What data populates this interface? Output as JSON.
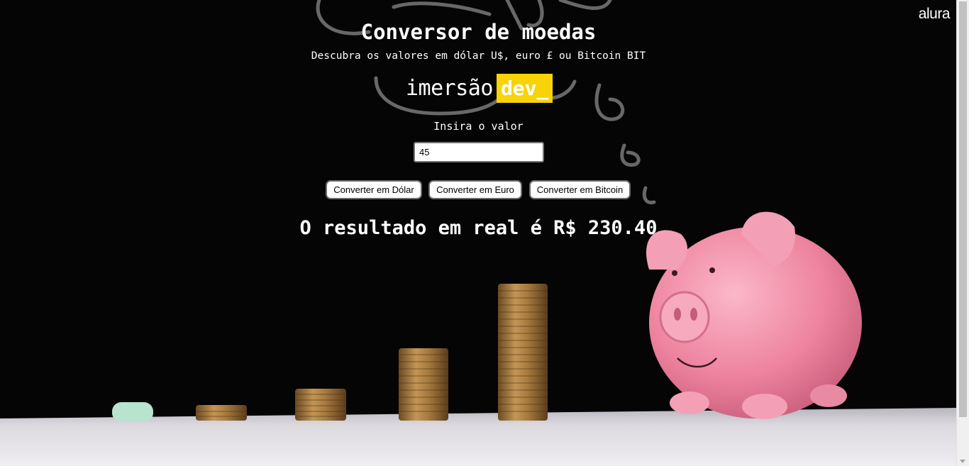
{
  "header": {
    "logo_text": "alura"
  },
  "main": {
    "title": "Conversor de moedas",
    "subtitle": "Descubra os valores em dólar U$, euro £ ou Bitcoin BIT",
    "brand": {
      "part1": "imersão",
      "part2": "dev_"
    },
    "input_label": "Insira o valor",
    "input_value": "45",
    "buttons": [
      {
        "label": "Converter em Dólar"
      },
      {
        "label": "Converter em Euro"
      },
      {
        "label": "Converter em Bitcoin"
      }
    ],
    "result": "O resultado em real é R$ 230.40"
  },
  "colors": {
    "background": "#050505",
    "brand_highlight": "#f7d307",
    "text": "#ffffff",
    "piggy": "#f08aa6"
  }
}
